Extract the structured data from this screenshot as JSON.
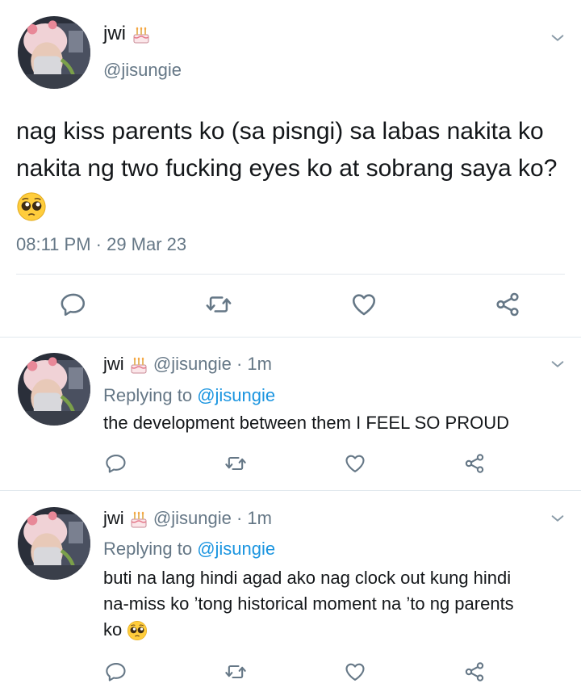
{
  "main_tweet": {
    "display_name": "jwi",
    "name_emoji": "birthday-cake-icon",
    "handle": "@jisungie",
    "text": "nag kiss parents ko (sa pisngi) sa labas nakita ko nakita ng two fucking eyes ko at sobrang saya ko?",
    "text_emoji": "pleading-face-icon",
    "timestamp": "08:11 PM · 29 Mar 23"
  },
  "replies": [
    {
      "display_name": "jwi",
      "name_emoji": "birthday-cake-icon",
      "handle": "@jisungie",
      "age": "· 1m",
      "replying_prefix": "Replying to",
      "replying_to": "@jisungie",
      "text": "the development between them I FEEL SO PROUD"
    },
    {
      "display_name": "jwi",
      "name_emoji": "birthday-cake-icon",
      "handle": "@jisungie",
      "age": "· 1m",
      "replying_prefix": "Replying to",
      "replying_to": "@jisungie",
      "text_lines": [
        "buti na lang hindi agad ako nag clock out kung hindi",
        "na-miss ko ’tong historical moment na ’to ng parents",
        "ko"
      ],
      "text_emoji": "pleading-face-icon"
    }
  ],
  "actions": [
    "reply-icon",
    "retweet-icon",
    "like-icon",
    "share-icon"
  ],
  "colors": {
    "text": "#14171a",
    "secondary": "#657786",
    "mention": "#1b95e0",
    "icon": "#657786",
    "divider": "#e1e8ed"
  }
}
